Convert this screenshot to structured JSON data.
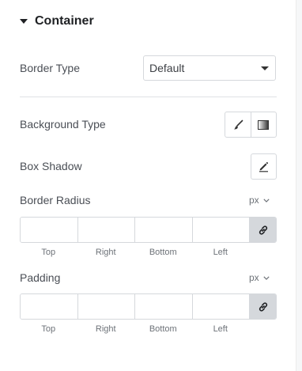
{
  "section": {
    "title": "Container"
  },
  "border_type": {
    "label": "Border Type",
    "value": "Default"
  },
  "background_type": {
    "label": "Background Type",
    "options": [
      "brush-icon",
      "gradient-icon"
    ]
  },
  "box_shadow": {
    "label": "Box Shadow",
    "icon": "pencil-icon"
  },
  "border_radius": {
    "label": "Border Radius",
    "unit": "px",
    "fields": [
      "Top",
      "Right",
      "Bottom",
      "Left"
    ],
    "values": [
      "",
      "",
      "",
      ""
    ],
    "link_icon": "link-icon"
  },
  "padding": {
    "label": "Padding",
    "unit": "px",
    "fields": [
      "Top",
      "Right",
      "Bottom",
      "Left"
    ],
    "values": [
      "",
      "",
      "",
      ""
    ],
    "link_icon": "link-icon"
  },
  "colors": {
    "linked_bg": "#d5d8dc",
    "border": "#d5d8dc",
    "text": "#4a4e55"
  }
}
